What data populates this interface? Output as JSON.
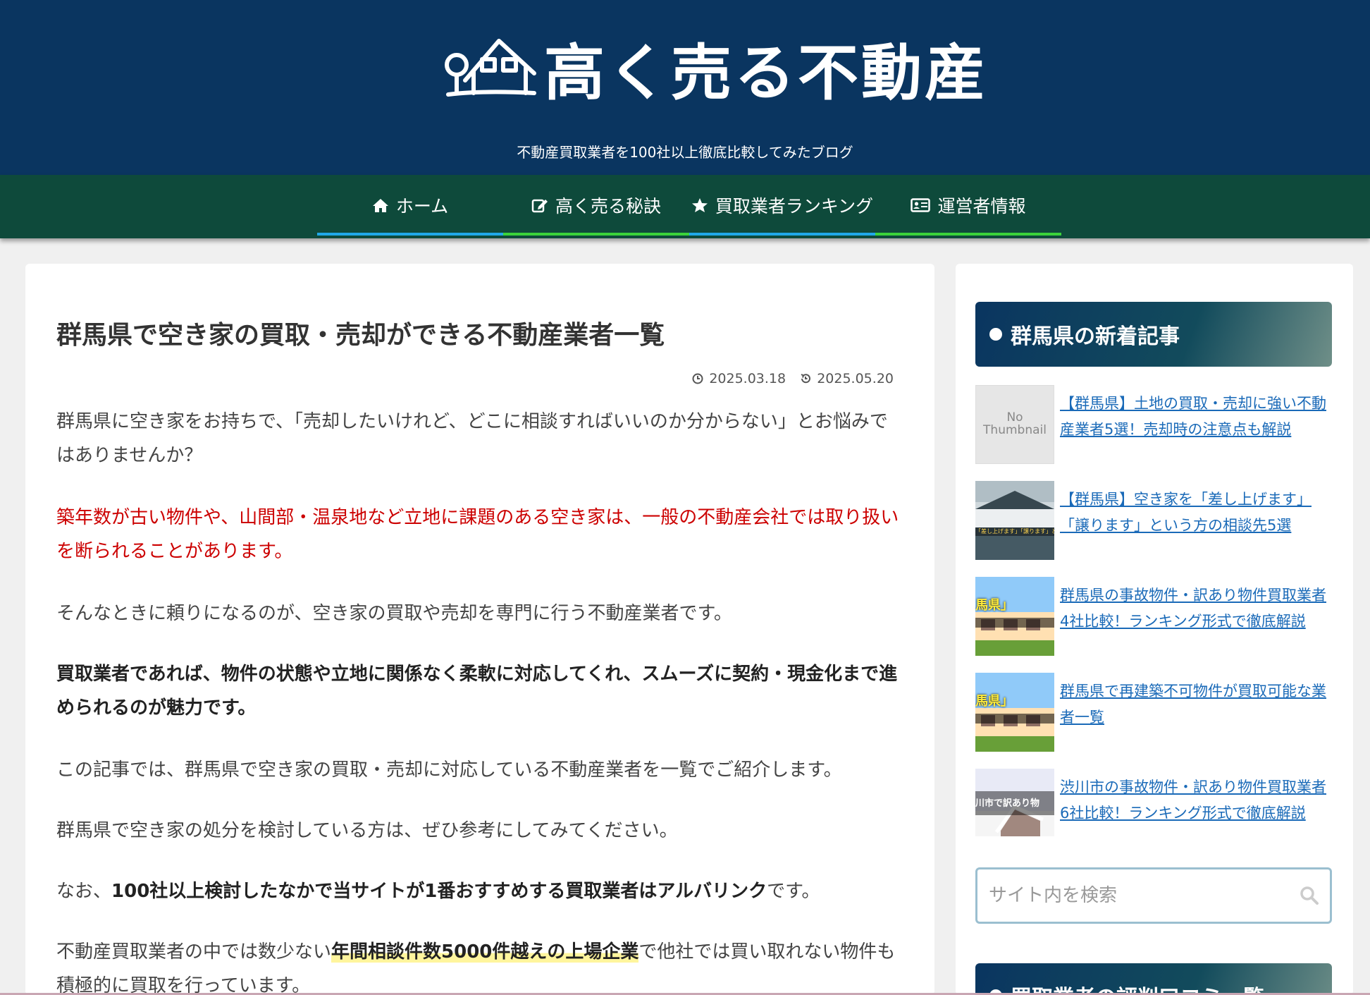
{
  "site": {
    "logo_text": "高く売る不動産",
    "tagline": "不動産買取業者を100社以上徹底比較してみたブログ"
  },
  "nav": {
    "items": [
      {
        "label": "ホーム",
        "icon": "home-icon",
        "bar_color": "#1fa8e8"
      },
      {
        "label": "高く売る秘訣",
        "icon": "edit-icon",
        "bar_color": "#3ad33a"
      },
      {
        "label": "買取業者ランキング",
        "icon": "star-icon",
        "bar_color": "#1fa8e8"
      },
      {
        "label": "運営者情報",
        "icon": "id-card-icon",
        "bar_color": "#3ad33a"
      }
    ]
  },
  "article": {
    "title": "群馬県で空き家の買取・売却ができる不動産業者一覧",
    "published": "2025.03.18",
    "updated": "2025.05.20",
    "p1": "群馬県に空き家をお持ちで、「売却したいけれど、どこに相談すればいいのか分からない」とお悩みではありませんか？",
    "p2_red": "築年数が古い物件や、山間部・温泉地など立地に課題のある空き家は、一般の不動産会社では取り扱いを断られることがあります。",
    "p3": "そんなときに頼りになるのが、空き家の買取や売却を専門に行う不動産業者です。",
    "p4_bold": "買取業者であれば、物件の状態や立地に関係なく柔軟に対応してくれ、スムーズに契約・現金化まで進められるのが魅力です。",
    "p5": "この記事では、群馬県で空き家の買取・売却に対応している不動産業者を一覧でご紹介します。",
    "p6": "群馬県で空き家の処分を検討している方は、ぜひ参考にしてみてください。",
    "p7_prefix": "なお、",
    "p7_bold": "100社以上検討したなかで当サイトが1番おすすめする買取業者はアルバリンク",
    "p7_suffix": "です。",
    "p8_prefix": "不動産買取業者の中では数少ない",
    "p8_highlight": "年間相談件数5000件越えの上場企業",
    "p8_suffix": "で他社では買い取れない物件も積極的に買取を行っています。"
  },
  "sidebar": {
    "widget_title": "群馬県の新着記事",
    "posts": [
      {
        "title": "【群馬県】土地の買取・売却に強い不動産業者5選！売却時の注意点も解説",
        "thumb_text": "No Thumbnail"
      },
      {
        "title": "【群馬県】空き家を「差し上げます」「譲ります」という方の相談先5選",
        "thumb_text": "「差し上げます」「譲ります」とい"
      },
      {
        "title": "群馬県の事故物件・訳あり物件買取業者4社比較！ランキング形式で徹底解説",
        "thumb_text": "馬県」"
      },
      {
        "title": "群馬県で再建築不可物件が買取可能な業者一覧",
        "thumb_text": "馬県」"
      },
      {
        "title": "渋川市の事故物件・訳あり物件買取業者6社比較！ランキング形式で徹底解説",
        "thumb_text": "川市で訳あり物"
      }
    ],
    "search_placeholder": "サイト内を検索",
    "widget2_title": "買取業者の評判口コミ一覧"
  }
}
